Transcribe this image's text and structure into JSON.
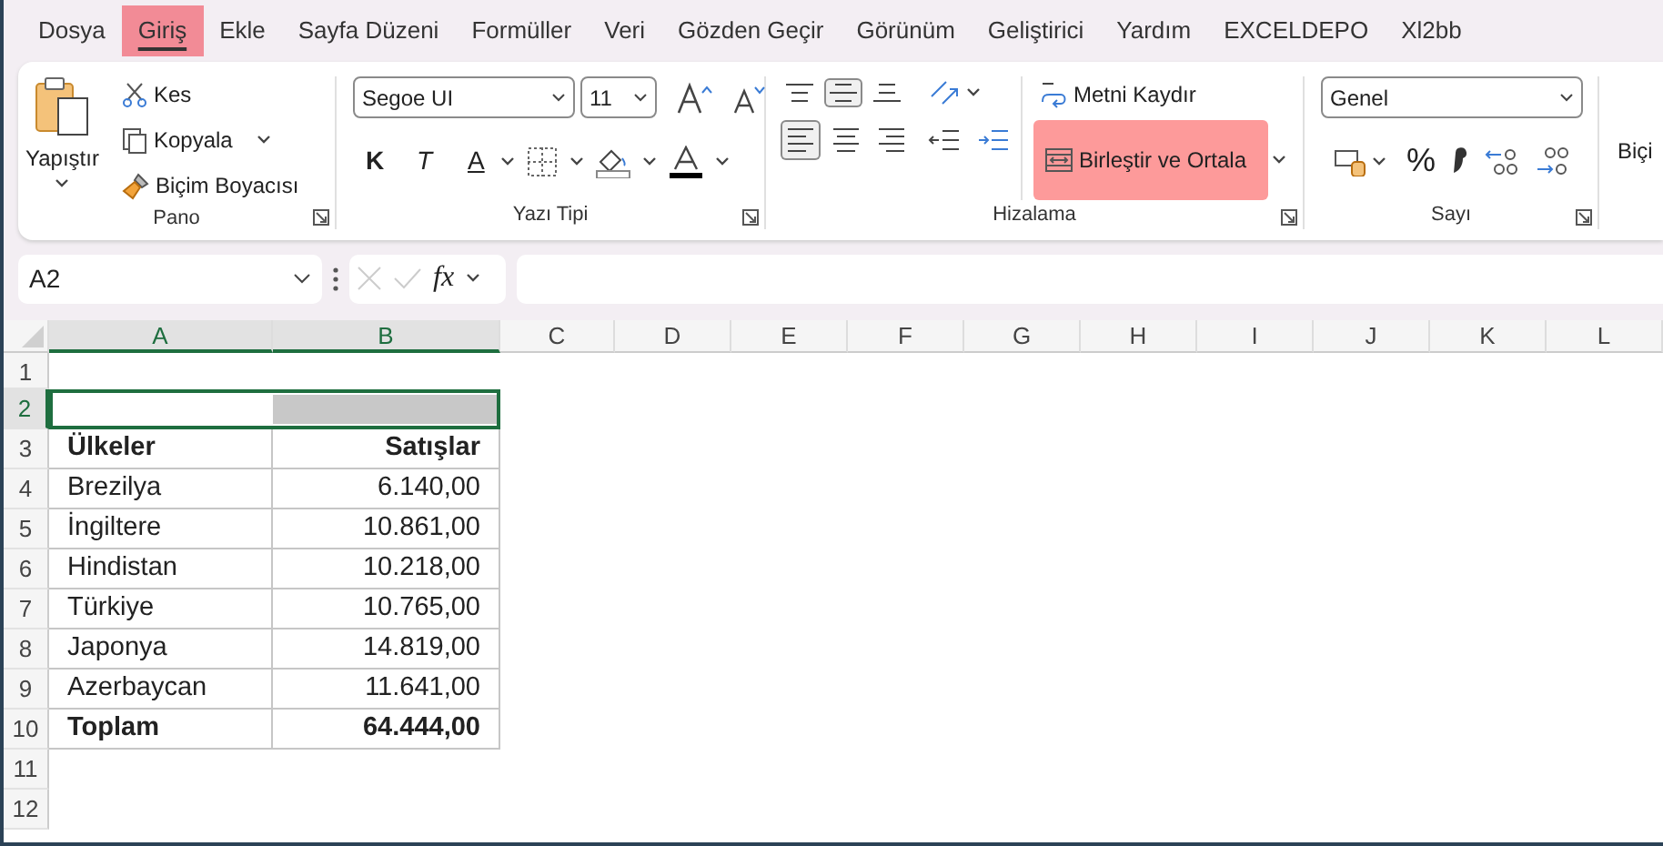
{
  "menu_tabs": [
    {
      "label": "Dosya",
      "selected": false,
      "highlighted": false
    },
    {
      "label": "Giriş",
      "selected": true,
      "highlighted": true
    },
    {
      "label": "Ekle",
      "selected": false,
      "highlighted": false
    },
    {
      "label": "Sayfa Düzeni",
      "selected": false,
      "highlighted": false
    },
    {
      "label": "Formüller",
      "selected": false,
      "highlighted": false
    },
    {
      "label": "Veri",
      "selected": false,
      "highlighted": false
    },
    {
      "label": "Gözden Geçir",
      "selected": false,
      "highlighted": false
    },
    {
      "label": "Görünüm",
      "selected": false,
      "highlighted": false
    },
    {
      "label": "Geliştirici",
      "selected": false,
      "highlighted": false
    },
    {
      "label": "Yardım",
      "selected": false,
      "highlighted": false
    },
    {
      "label": "EXCELDEPO",
      "selected": false,
      "highlighted": false
    },
    {
      "label": "Xl2bb",
      "selected": false,
      "highlighted": false
    }
  ],
  "ribbon": {
    "clipboard": {
      "paste": "Yapıştır",
      "cut": "Kes",
      "copy": "Kopyala",
      "format_painter": "Biçim Boyacısı",
      "label": "Pano"
    },
    "font": {
      "font_name": "Segoe UI",
      "font_size": "11",
      "bold": "K",
      "italic": "T",
      "underline": "A",
      "label": "Yazı Tipi"
    },
    "alignment": {
      "vertical_buttons": [
        {
          "selected": false
        },
        {
          "selected": true
        },
        {
          "selected": false
        }
      ],
      "horizontal_buttons": [
        {
          "selected": true
        },
        {
          "selected": false
        },
        {
          "selected": false
        }
      ],
      "wrap_text": "Metni Kaydır",
      "merge": {
        "label": "Birleştir ve Ortala",
        "highlighted": true
      },
      "label": "Hizalama"
    },
    "number": {
      "format": "Genel",
      "percent": "%",
      "label": "Sayı"
    },
    "next_group": "Biçi"
  },
  "formula_bar": {
    "name_box": "A2",
    "fx": "fx"
  },
  "sheet": {
    "columns": [
      {
        "label": "A",
        "selected": true
      },
      {
        "label": "B",
        "selected": true
      },
      {
        "label": "C",
        "selected": false
      },
      {
        "label": "D",
        "selected": false
      },
      {
        "label": "E",
        "selected": false
      },
      {
        "label": "F",
        "selected": false
      },
      {
        "label": "G",
        "selected": false
      },
      {
        "label": "H",
        "selected": false
      },
      {
        "label": "I",
        "selected": false
      },
      {
        "label": "J",
        "selected": false
      },
      {
        "label": "K",
        "selected": false
      },
      {
        "label": "L",
        "selected": false
      }
    ],
    "rows": [
      {
        "label": "1",
        "selected": false
      },
      {
        "label": "2",
        "selected": true,
        "cells": [
          {
            "selected": true
          },
          {
            "selected": true,
            "shaded": true
          }
        ]
      },
      {
        "label": "3",
        "selected": false,
        "bold": true,
        "cells": [
          {
            "text": "Ülkeler"
          },
          {
            "text": "Satışlar"
          }
        ]
      },
      {
        "label": "4",
        "selected": false,
        "cells": [
          {
            "text": "Brezilya"
          },
          {
            "text": "6.140,00"
          }
        ]
      },
      {
        "label": "5",
        "selected": false,
        "cells": [
          {
            "text": "İngiltere"
          },
          {
            "text": "10.861,00"
          }
        ]
      },
      {
        "label": "6",
        "selected": false,
        "cells": [
          {
            "text": "Hindistan"
          },
          {
            "text": "10.218,00"
          }
        ]
      },
      {
        "label": "7",
        "selected": false,
        "cells": [
          {
            "text": "Türkiye"
          },
          {
            "text": "10.765,00"
          }
        ]
      },
      {
        "label": "8",
        "selected": false,
        "cells": [
          {
            "text": "Japonya"
          },
          {
            "text": "14.819,00"
          }
        ]
      },
      {
        "label": "9",
        "selected": false,
        "cells": [
          {
            "text": "Azerbaycan"
          },
          {
            "text": "11.641,00"
          }
        ]
      },
      {
        "label": "10",
        "selected": false,
        "bold": true,
        "cells": [
          {
            "text": "Toplam"
          },
          {
            "text": "64.444,00"
          }
        ]
      },
      {
        "label": "11",
        "selected": false
      },
      {
        "label": "12",
        "selected": false
      }
    ]
  }
}
